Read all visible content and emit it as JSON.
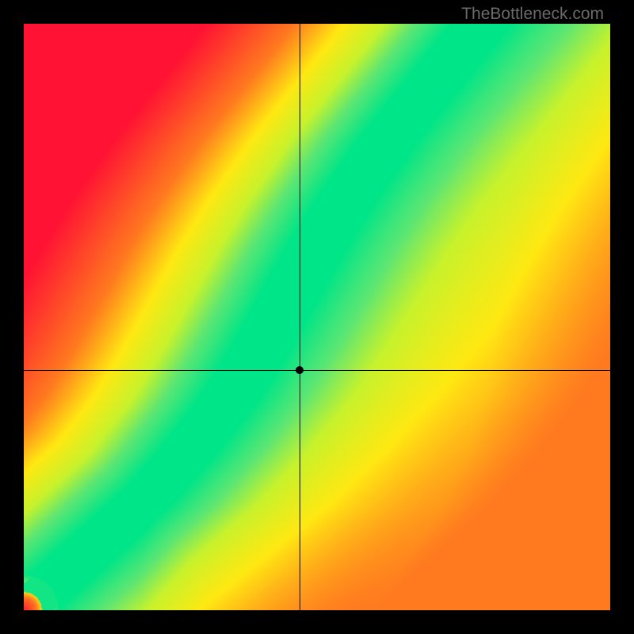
{
  "watermark": "TheBottleneck.com",
  "chart_data": {
    "type": "heatmap",
    "title": "",
    "xlabel": "",
    "ylabel": "",
    "xlim": [
      0,
      100
    ],
    "ylim": [
      0,
      100
    ],
    "marker": {
      "x": 47,
      "y": 41
    },
    "crosshair": {
      "x": 47,
      "y": 41
    },
    "optimal_band": {
      "description": "Green band along roughly y = f(x); crosshair marker sits slightly right of band center",
      "points": [
        {
          "x": 0,
          "y": 0
        },
        {
          "x": 10,
          "y": 9
        },
        {
          "x": 20,
          "y": 18
        },
        {
          "x": 28,
          "y": 27
        },
        {
          "x": 35,
          "y": 36
        },
        {
          "x": 40,
          "y": 44
        },
        {
          "x": 45,
          "y": 53
        },
        {
          "x": 50,
          "y": 62
        },
        {
          "x": 55,
          "y": 70
        },
        {
          "x": 62,
          "y": 80
        },
        {
          "x": 70,
          "y": 90
        },
        {
          "x": 78,
          "y": 100
        }
      ],
      "band_half_width": 5
    },
    "color_scale": {
      "0.00": "#ff1233",
      "0.35": "#ff7a1f",
      "0.55": "#ffe812",
      "0.72": "#c7f22c",
      "0.85": "#5ce673",
      "1.00": "#00e588"
    }
  }
}
